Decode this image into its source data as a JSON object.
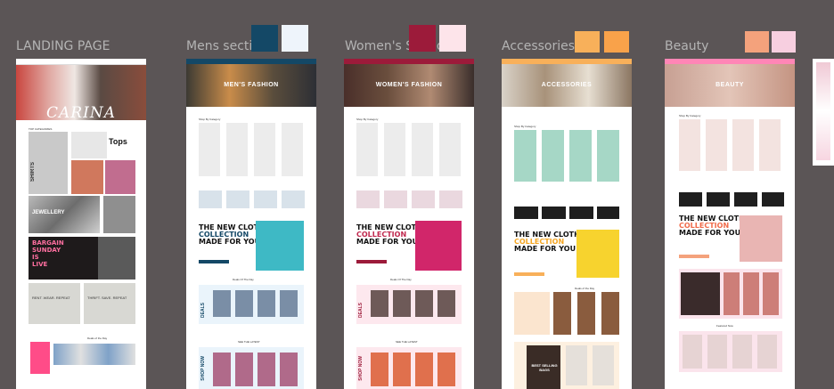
{
  "sections": [
    {
      "label": "LANDING PAGE"
    },
    {
      "label": "Mens section",
      "hero": "MEN'S FASHION"
    },
    {
      "label": "Women's Section",
      "hero": "WOMEN'S FASHION"
    },
    {
      "label": "Accessories",
      "hero": "ACCESSORIES"
    },
    {
      "label": "Beauty",
      "hero": "BEAUTY"
    }
  ],
  "swatches": {
    "mens": [
      "#144866",
      "#eef4fb"
    ],
    "womens": [
      "#9c1b3a",
      "#fde4ea"
    ],
    "accessories": [
      "#f8b05a",
      "#f9a24a"
    ],
    "beauty": [
      "#f4a27c",
      "#f7cfe0"
    ]
  },
  "landing": {
    "brand": "CARINA",
    "top_categories": "TOP CATEGORIES",
    "tops": "Tops",
    "shirts": "SHIRTS",
    "jewellery": "JEWELLERY",
    "bargain": [
      "BARGAIN",
      "SUNDAY",
      "IS",
      "LIVE"
    ],
    "rent": "RENT. WEAR. REPEAT",
    "thrift": "THRIFT. SAVE. REPEAT",
    "deals": "Deals of the Day"
  },
  "common": {
    "shop_by": "Shop By Category",
    "new_cloth": [
      "THE NEW CLOTH",
      "COLLECTION",
      "MADE FOR YOU"
    ],
    "deals": "DEALS",
    "deals_of_day": "Deals Of The Day",
    "see_latest": "SEE THE LATEST",
    "shop_now": "SHOP NOW"
  },
  "accessories": {
    "best_selling": [
      "BEST SELLING",
      "BAGS"
    ],
    "deals_of_day": "Deals of the Day"
  },
  "beauty": {
    "featured": "Featured Now"
  }
}
